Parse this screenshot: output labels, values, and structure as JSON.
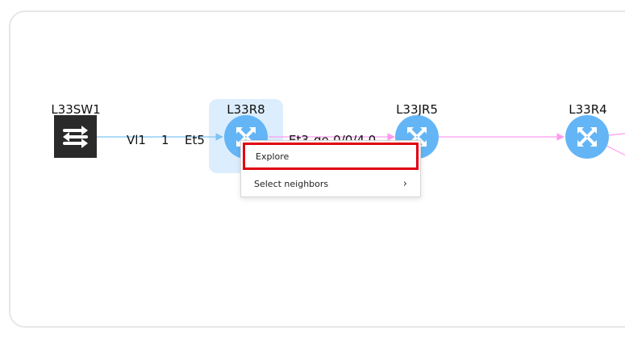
{
  "topology": {
    "nodes": [
      {
        "label": "L33SW1",
        "type": "switch"
      },
      {
        "label": "L33R8",
        "type": "router",
        "selected": true
      },
      {
        "label": "L33JR5",
        "type": "router"
      },
      {
        "label": "L33R4",
        "type": "router"
      }
    ],
    "edges": [
      {
        "source_port": "Vl1",
        "middle": "1",
        "target_port": "Et5"
      },
      {
        "source_port": "Et3",
        "target_port": "ge-0/0/4.0"
      }
    ],
    "colors": {
      "switch_link": "#7ec3f3",
      "router_link": "#ff9af0",
      "router_fill": "#64b5f6",
      "selection": "#dceefe"
    }
  },
  "context_menu": {
    "items": [
      {
        "label": "Explore",
        "highlighted": true
      },
      {
        "label": "Select neighbors",
        "submenu_icon": "chevron-right-icon"
      }
    ],
    "chevron": "›"
  }
}
